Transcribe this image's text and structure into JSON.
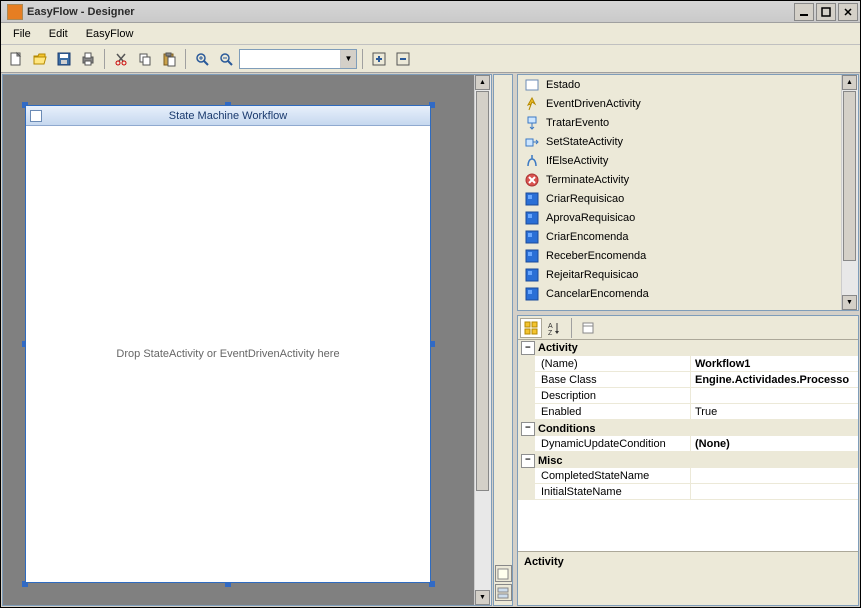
{
  "window": {
    "title": "EasyFlow - Designer"
  },
  "menus": {
    "file": "File",
    "edit": "Edit",
    "easyflow": "EasyFlow"
  },
  "toolbar": {
    "new": "New",
    "open": "Open",
    "save": "Save",
    "print": "Print",
    "cut": "Cut",
    "copy": "Copy",
    "paste": "Paste",
    "zoomin": "Zoom In",
    "zoomout": "Zoom Out",
    "combo_value": "",
    "expand": "+",
    "collapse": "−"
  },
  "workflow": {
    "title": "State Machine Workflow",
    "drop_hint": "Drop StateActivity or EventDrivenActivity here"
  },
  "toolbox": {
    "items": [
      {
        "label": "Estado",
        "icon": "state"
      },
      {
        "label": "EventDrivenActivity",
        "icon": "event"
      },
      {
        "label": "TratarEvento",
        "icon": "handle"
      },
      {
        "label": "SetStateActivity",
        "icon": "setstate"
      },
      {
        "label": "IfElseActivity",
        "icon": "ifelse"
      },
      {
        "label": "TerminateActivity",
        "icon": "terminate"
      },
      {
        "label": "CriarRequisicao",
        "icon": "custom"
      },
      {
        "label": "AprovaRequisicao",
        "icon": "custom"
      },
      {
        "label": "CriarEncomenda",
        "icon": "custom"
      },
      {
        "label": "ReceberEncomenda",
        "icon": "custom"
      },
      {
        "label": "RejeitarRequisicao",
        "icon": "custom"
      },
      {
        "label": "CancelarEncomenda",
        "icon": "custom"
      }
    ]
  },
  "properties": {
    "categories": [
      {
        "name": "Activity",
        "rows": [
          {
            "name": "(Name)",
            "value": "Workflow1",
            "bold": true
          },
          {
            "name": "Base Class",
            "value": "Engine.Actividades.Processo",
            "bold": true
          },
          {
            "name": "Description",
            "value": ""
          },
          {
            "name": "Enabled",
            "value": "True"
          }
        ]
      },
      {
        "name": "Conditions",
        "rows": [
          {
            "name": "DynamicUpdateCondition",
            "value": "(None)",
            "bold": true
          }
        ]
      },
      {
        "name": "Misc",
        "rows": [
          {
            "name": "CompletedStateName",
            "value": ""
          },
          {
            "name": "InitialStateName",
            "value": ""
          }
        ]
      }
    ],
    "desc_title": "Activity",
    "desc_text": ""
  }
}
